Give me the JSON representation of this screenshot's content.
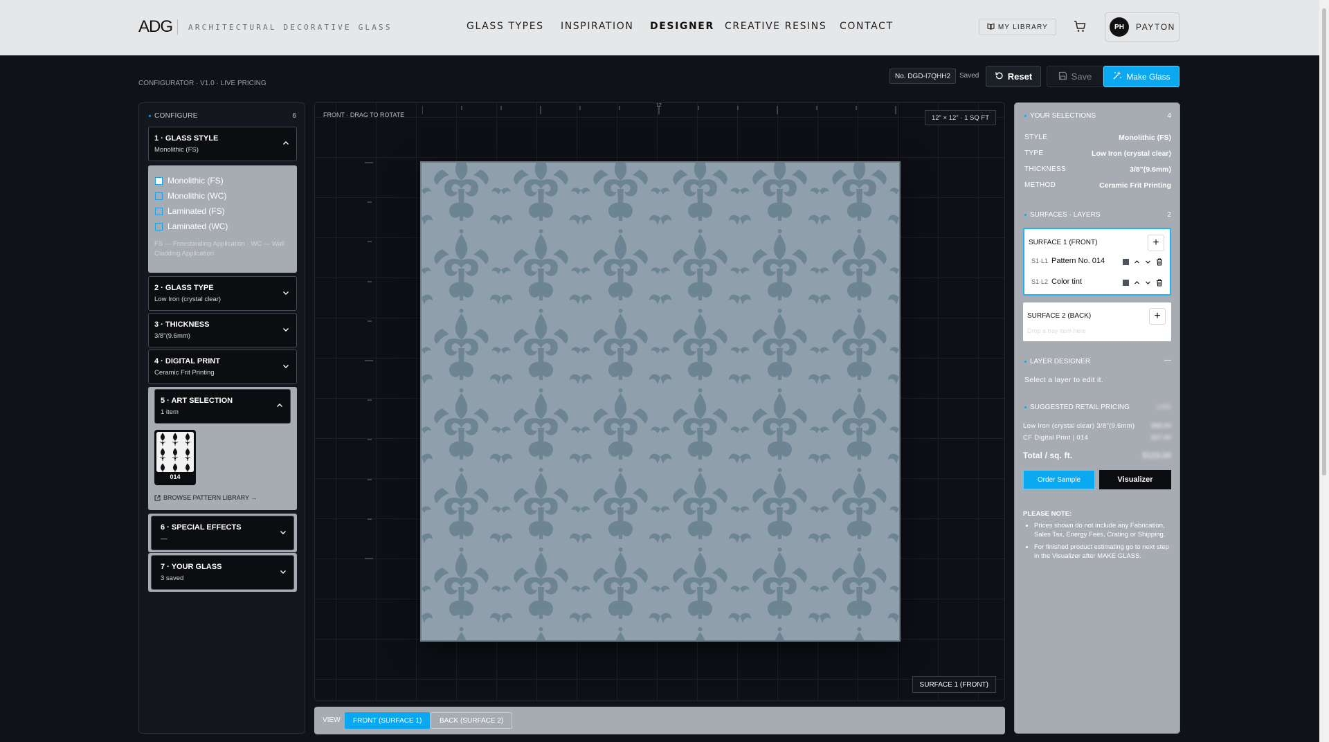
{
  "header": {
    "logo": "ADG",
    "tagline": "ARCHITECTURAL DECORATIVE GLASS",
    "nav": [
      "GLASS TYPES",
      "INSPIRATION",
      "DESIGNER",
      "CREATIVE RESINS",
      "CONTACT"
    ],
    "active_nav": "DESIGNER",
    "library_label": "MY LIBRARY",
    "user_initials": "PH",
    "user_name": "PAYTON"
  },
  "breadcrumb": "CONFIGURATOR · V1.0 · LIVE PRICING",
  "toolbar": {
    "doc_number": "No. DGD-I7QHH2",
    "saved_label": "Saved",
    "reset_label": "Reset",
    "save_label": "Save",
    "make_label": "Make Glass"
  },
  "configure": {
    "title": "CONFIGURE",
    "count": "6",
    "sections": [
      {
        "title": "1 · GLASS STYLE",
        "value": "Monolithic (FS)",
        "expanded": true
      },
      {
        "title": "2 · GLASS TYPE",
        "value": "Low Iron (crystal clear)",
        "expanded": false
      },
      {
        "title": "3 · THICKNESS",
        "value": "3/8\"(9.6mm)",
        "expanded": false
      },
      {
        "title": "4 · DIGITAL PRINT",
        "value": "Ceramic Frit Printing",
        "expanded": false
      },
      {
        "title": "5 · ART SELECTION",
        "value": "1 item",
        "expanded": true
      },
      {
        "title": "6 · SPECIAL EFFECTS",
        "value": "—",
        "expanded": false
      },
      {
        "title": "7 · YOUR GLASS",
        "value": "3 saved",
        "expanded": false
      }
    ],
    "style_options": [
      {
        "label": "Monolithic (FS)",
        "checked": true
      },
      {
        "label": "Monolithic (WC)",
        "checked": false
      },
      {
        "label": "Laminated (FS)",
        "checked": false
      },
      {
        "label": "Laminated (WC)",
        "checked": false
      }
    ],
    "style_note": "FS — Freestanding Application · WC — Wall Cladding Application",
    "art_item_label": "014",
    "browse_label": "BROWSE PATTERN LIBRARY →"
  },
  "canvas": {
    "label": "FRONT · DRAG TO ROTATE",
    "size_badge": "12\" × 12\" · 1 SQ FT",
    "ruler_mark": "12",
    "surface_badge": "SURFACE 1 (FRONT)",
    "glass_color": "#8f9fab",
    "pattern_color": "#6d8493"
  },
  "viewbar": {
    "label": "VIEW",
    "front": "FRONT (SURFACE 1)",
    "back": "BACK (SURFACE 2)"
  },
  "selections": {
    "title": "YOUR SELECTIONS",
    "count": "4",
    "rows": [
      {
        "k": "STYLE",
        "v": "Monolithic (FS)"
      },
      {
        "k": "TYPE",
        "v": "Low Iron (crystal clear)"
      },
      {
        "k": "THICKNESS",
        "v": "3/8\"(9.6mm)"
      },
      {
        "k": "METHOD",
        "v": "Ceramic Frit Printing"
      }
    ]
  },
  "surfaces": {
    "title": "SURFACES · LAYERS",
    "count": "2",
    "surface1": {
      "title": "SURFACE 1 (FRONT)",
      "layers": [
        {
          "id": "S1·L1",
          "name": "Pattern No. 014"
        },
        {
          "id": "S1·L2",
          "name": "Color tint"
        }
      ]
    },
    "surface2": {
      "title": "SURFACE 2 (BACK)",
      "hint": "Drop a tray item here"
    }
  },
  "layer_designer": {
    "title": "LAYER DESIGNER",
    "dash": "—",
    "hint": "Select a layer to edit it."
  },
  "pricing": {
    "title": "SUGGESTED RETAIL PRICING",
    "currency": "USD",
    "line1_label": "Low Iron (crystal clear) 3/8\"(9.6mm)",
    "line1_value": "$96.00",
    "line2_label": "CF Digital Print | 014",
    "line2_value": "$27.00",
    "total_label": "Total / sq. ft.",
    "total_value": "$123.00",
    "order_label": "Order Sample",
    "visualizer_label": "Visualizer"
  },
  "notes": {
    "title": "PLEASE NOTE:",
    "items": [
      "Prices shown do not include any Fabrication, Sales Tax, Energy Fees, Crating or Shipping.",
      "For finished product estimating go to next step in the Visualizer after MAKE GLASS."
    ]
  }
}
